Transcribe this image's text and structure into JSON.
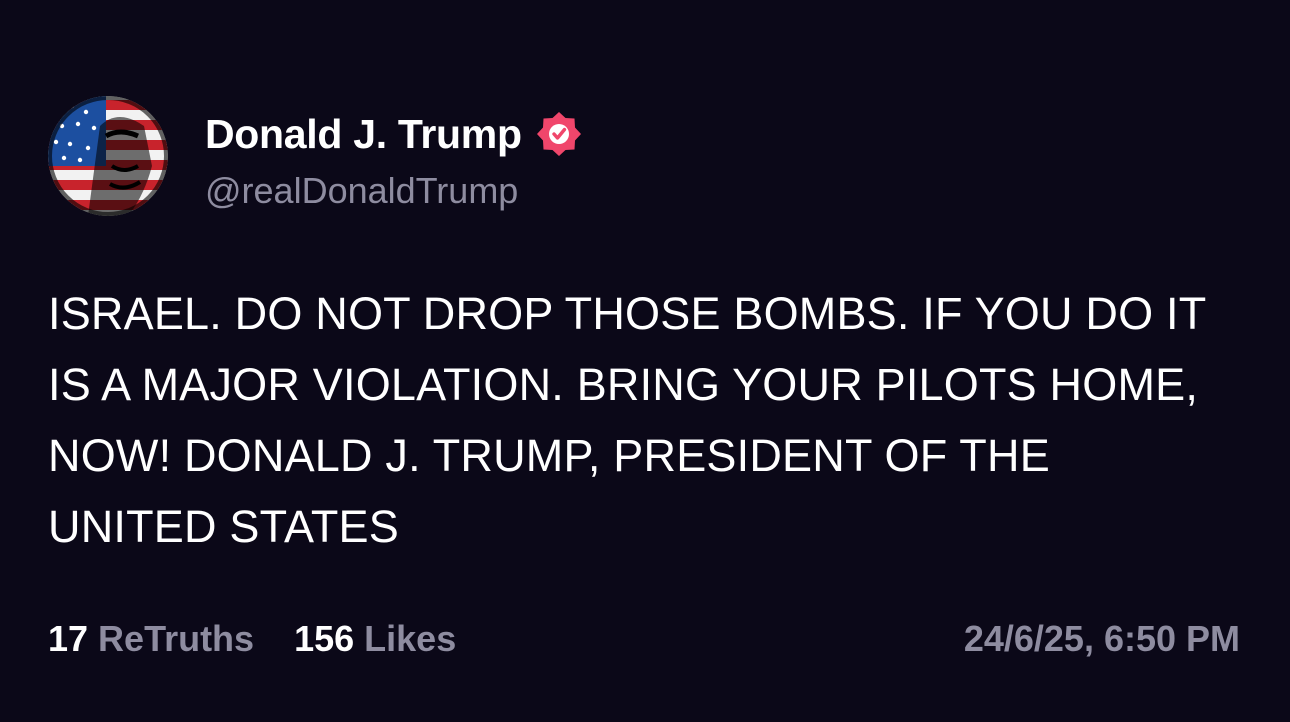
{
  "author": {
    "display_name": "Donald J. Trump",
    "handle": "@realDonaldTrump",
    "verified_icon": "verified-badge-icon",
    "verified_color": "#f0466b"
  },
  "post": {
    "text": "ISRAEL. DO NOT DROP THOSE BOMBS. IF YOU DO IT IS A MAJOR VIOLATION. BRING YOUR PILOTS HOME, NOW! DONALD J. TRUMP, PRESIDENT OF THE UNITED STATES"
  },
  "stats": {
    "retruths_count": "17",
    "retruths_label": "ReTruths",
    "likes_count": "156",
    "likes_label": "Likes"
  },
  "timestamp": "24/6/25, 6:50 PM",
  "colors": {
    "background": "#0b0818",
    "primary_text": "#ffffff",
    "secondary_text": "#8e8ca0"
  }
}
